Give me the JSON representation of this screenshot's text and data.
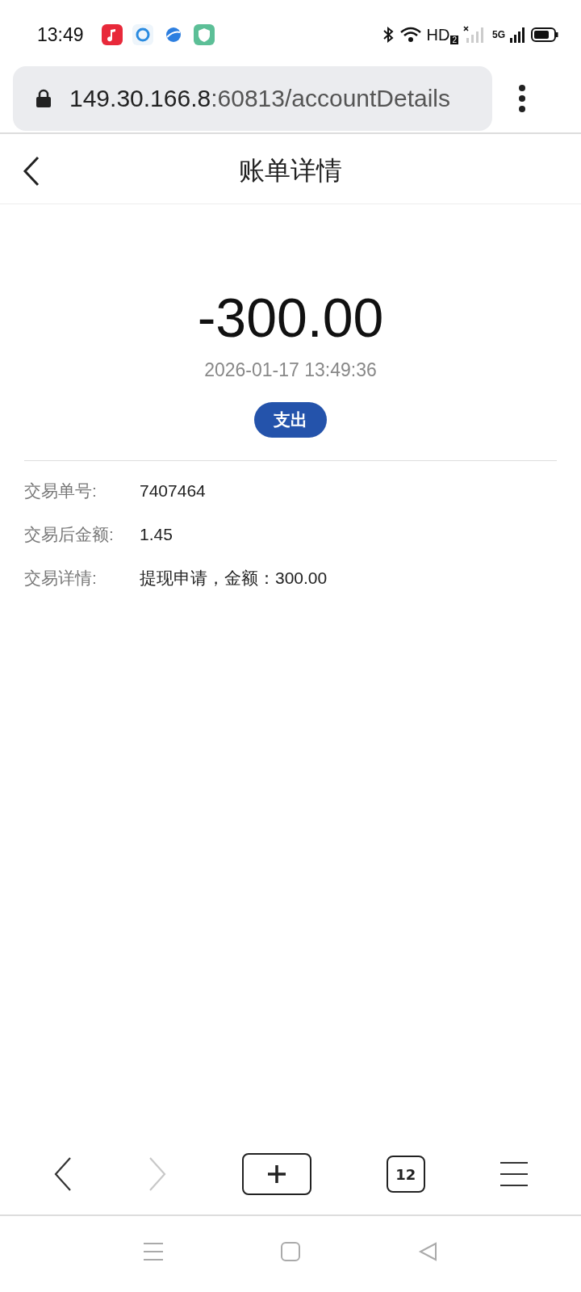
{
  "status_bar": {
    "time": "13:49",
    "network_label": "HD",
    "sim_label": "2",
    "cellular_label": "5G"
  },
  "address_bar": {
    "host": "149.30.166.8",
    "path": ":60813/accountDetails"
  },
  "header": {
    "title": "账单详情"
  },
  "transaction": {
    "amount": "-300.00",
    "datetime": "2026-01-17 13:49:36",
    "type_badge": "支出"
  },
  "details": [
    {
      "label": "交易单号:",
      "value": "7407464"
    },
    {
      "label": "交易后金额:",
      "value": "1.45"
    },
    {
      "label": "交易详情:",
      "value": "提现申请，金额：300.00"
    }
  ],
  "browser_toolbar": {
    "back": {
      "disabled": false
    },
    "forward": {
      "disabled": true
    },
    "tab_count": "12"
  }
}
